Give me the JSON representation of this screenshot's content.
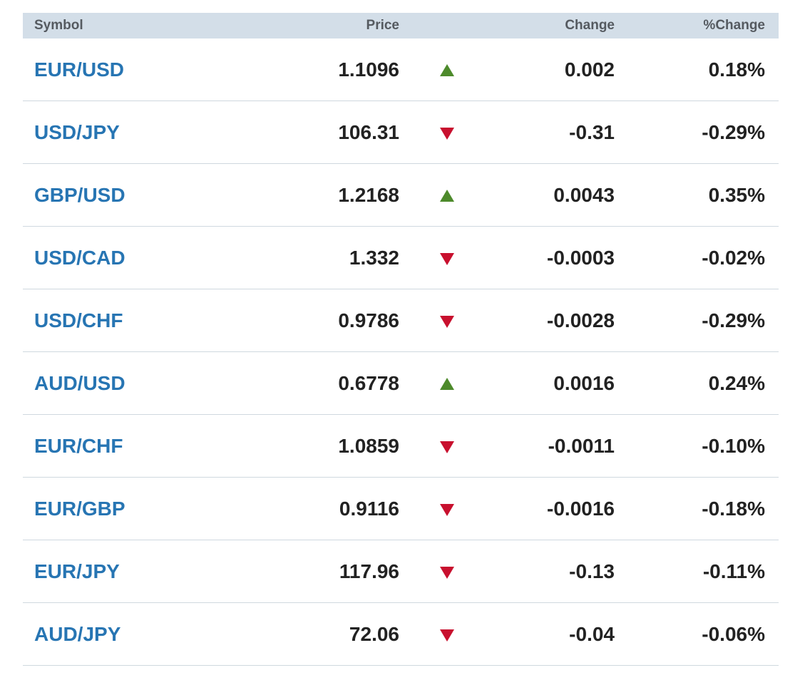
{
  "columns": {
    "symbol": "Symbol",
    "price": "Price",
    "change": "Change",
    "pct_change": "%Change"
  },
  "colors": {
    "link": "#2775b3",
    "header_bg": "#d3dee8",
    "up": "#4d8a2b",
    "down": "#c8102e"
  },
  "rows": [
    {
      "symbol": "EUR/USD",
      "price": "1.1096",
      "direction": "up",
      "change": "0.002",
      "pct_change": "0.18%"
    },
    {
      "symbol": "USD/JPY",
      "price": "106.31",
      "direction": "down",
      "change": "-0.31",
      "pct_change": "-0.29%"
    },
    {
      "symbol": "GBP/USD",
      "price": "1.2168",
      "direction": "up",
      "change": "0.0043",
      "pct_change": "0.35%"
    },
    {
      "symbol": "USD/CAD",
      "price": "1.332",
      "direction": "down",
      "change": "-0.0003",
      "pct_change": "-0.02%"
    },
    {
      "symbol": "USD/CHF",
      "price": "0.9786",
      "direction": "down",
      "change": "-0.0028",
      "pct_change": "-0.29%"
    },
    {
      "symbol": "AUD/USD",
      "price": "0.6778",
      "direction": "up",
      "change": "0.0016",
      "pct_change": "0.24%"
    },
    {
      "symbol": "EUR/CHF",
      "price": "1.0859",
      "direction": "down",
      "change": "-0.0011",
      "pct_change": "-0.10%"
    },
    {
      "symbol": "EUR/GBP",
      "price": "0.9116",
      "direction": "down",
      "change": "-0.0016",
      "pct_change": "-0.18%"
    },
    {
      "symbol": "EUR/JPY",
      "price": "117.96",
      "direction": "down",
      "change": "-0.13",
      "pct_change": "-0.11%"
    },
    {
      "symbol": "AUD/JPY",
      "price": "72.06",
      "direction": "down",
      "change": "-0.04",
      "pct_change": "-0.06%"
    }
  ]
}
